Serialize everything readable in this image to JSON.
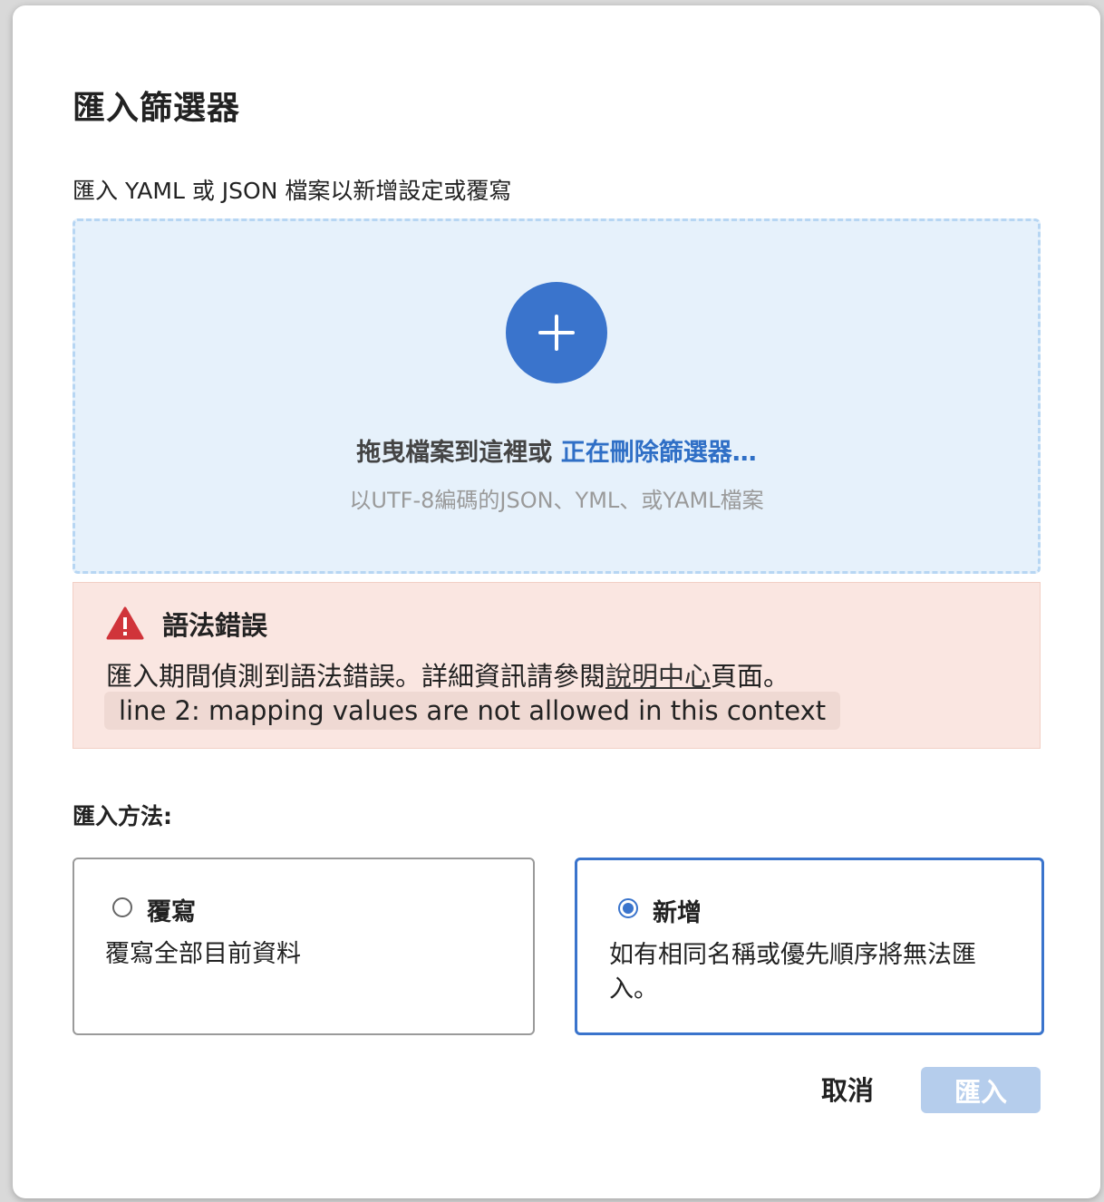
{
  "dialog": {
    "title": "匯入篩選器",
    "subtitle": "匯入 YAML 或 JSON 檔案以新增設定或覆寫"
  },
  "dropzone": {
    "prompt": "拖曳檔案到這裡或 ",
    "link_text": "正在刪除篩選器…",
    "hint": "以UTF-8編碼的JSON、YML、或YAML檔案",
    "add_icon": "plus-icon"
  },
  "error": {
    "icon": "warning-icon",
    "title": "語法錯誤",
    "message_prefix": "匯入期間偵測到語法錯誤。詳細資訊請參閱",
    "help_link": "說明中心",
    "message_suffix": "頁面。",
    "code": "line 2: mapping values are not allowed in this context",
    "colors": {
      "background": "#fae6e1",
      "icon": "#d0343a"
    }
  },
  "import_method": {
    "label": "匯入方法:",
    "selected": "add",
    "options": [
      {
        "id": "overwrite",
        "title": "覆寫",
        "description": "覆寫全部目前資料"
      },
      {
        "id": "add",
        "title": "新增",
        "description": "如有相同名稱或優先順序將無法匯入。"
      }
    ]
  },
  "footer": {
    "cancel_label": "取消",
    "import_label": "匯入",
    "import_disabled": true
  },
  "accent_color": "#3a74cc"
}
